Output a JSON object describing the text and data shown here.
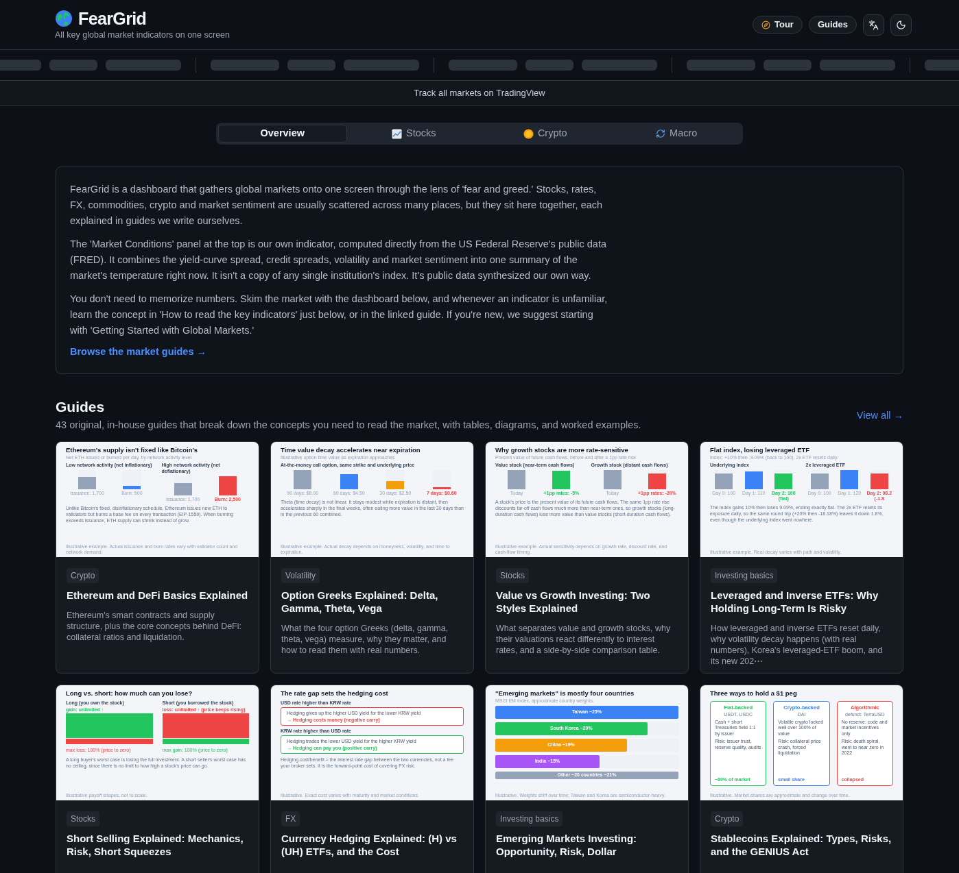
{
  "header": {
    "brand": "FearGrid",
    "tagline": "All key global market indicators on one screen",
    "buttons": [
      {
        "kind": "tour",
        "label": "Tour"
      },
      {
        "kind": "plain",
        "label": "Guides"
      },
      {
        "kind": "translate"
      },
      {
        "kind": "theme"
      }
    ]
  },
  "tradingview_link": "Track all markets on TradingView",
  "tabs": [
    {
      "label": "Overview",
      "selected": true
    },
    {
      "label": "Stocks",
      "selected": false
    },
    {
      "label": "Crypto",
      "selected": false
    },
    {
      "label": "Macro",
      "selected": false
    }
  ],
  "intro": {
    "paragraphs": [
      "FearGrid is a dashboard that gathers global markets onto one screen through the lens of 'fear and greed.' Stocks, rates, FX, commodities, crypto and market sentiment are usually scattered across many places, but they sit here together, each explained in guides we write ourselves.",
      "The 'Market Conditions' panel at the top is our own indicator, computed directly from the US Federal Reserve's public data (FRED). It combines the yield-curve spread, credit spreads, volatility and market sentiment into one summary of the market's temperature right now. It isn't a copy of any single institution's index. It's public data synthesized our own way.",
      "You don't need to memorize numbers. Skim the market with the dashboard below, and whenever an indicator is unfamiliar, learn the concept in 'How to read the key indicators' just below, or in the linked guide. If you're new, we suggest starting with 'Getting Started with Global Markets.'"
    ],
    "link": "Browse the market guides →"
  },
  "guides": {
    "title": "Guides",
    "subtitle": "43 original, in-house guides that break down the concepts you need to read the market, with tables, diagrams, and worked examples.",
    "view_all": "View all →",
    "cards": [
      {
        "category": "Crypto",
        "title": "Ethereum and DeFi Basics Explained",
        "description": "Ethereum's smart contracts and supply structure, plus the core concepts behind DeFi: collateral ratios and liquidation.",
        "thumb": {
          "kind": "bars",
          "title": "Ethereum's supply isn't fixed like Bitcoin's",
          "subtitle": "Net ETH issued or burned per day, by network activity level",
          "groups": [
            {
              "heading": "Low network activity (net inflationary)",
              "bars": [
                {
                  "label": "Issuance: 1,700",
                  "level": 0.65,
                  "color": "#94a3b8",
                  "highlight": false
                },
                {
                  "label": "Burn: 500",
                  "level": 0.18,
                  "color": "#3b82f6",
                  "highlight": false
                }
              ]
            },
            {
              "heading": "High network activity (net deflationary)",
              "bars": [
                {
                  "label": "Issuance: 1,700",
                  "level": 0.65,
                  "color": "#94a3b8",
                  "highlight": false
                },
                {
                  "label": "Burn: 2,500",
                  "level": 1,
                  "color": "#ef4444",
                  "highlight": true
                }
              ]
            }
          ],
          "body": "Unlike Bitcoin's fixed, disinflationary schedule, Ethereum issues new ETH to validators but burns a base fee on every transaction (EIP-1559). When burning exceeds issuance, ETH supply can shrink instead of grow.",
          "footnote": "Illustrative example. Actual issuance and burn rates vary with validator count and network demand."
        }
      },
      {
        "category": "Volatility",
        "title": "Option Greeks Explained: Delta, Gamma, Theta, Vega",
        "description": "What the four option Greeks (delta, gamma, theta, vega) measure, why they matter, and how to read them with real numbers.",
        "thumb": {
          "kind": "bars",
          "title": "Time value decay accelerates near expiration",
          "subtitle": "Illustrative option time value as expiration approaches",
          "groups": [
            {
              "heading": "At-the-money call option, same strike and underlying price",
              "bars": [
                {
                  "label": "90 days: $6.00",
                  "level": 1,
                  "color": "#94a3b8",
                  "highlight": false
                },
                {
                  "label": "60 days: $4.50",
                  "level": 0.76,
                  "color": "#3b82f6",
                  "highlight": false
                },
                {
                  "label": "30 days: $2.50",
                  "level": 0.42,
                  "color": "#f59e0b",
                  "highlight": false
                },
                {
                  "label": "7 days: $0.60",
                  "level": 0.1,
                  "color": "#ef4444",
                  "highlight": true
                }
              ]
            }
          ],
          "body": "Theta (time decay) is not linear. It stays modest while expiration is distant, then accelerates sharply in the final weeks, often eating more value in the last 30 days than in the previous 60 combined.",
          "footnote": "Illustrative example. Actual decay depends on moneyness, volatility, and time to expiration."
        }
      },
      {
        "category": "Stocks",
        "title": "Value vs Growth Investing: Two Styles Explained",
        "description": "What separates value and growth stocks, why their valuations react differently to interest rates, and a side-by-side comparison table.",
        "thumb": {
          "kind": "bars",
          "title": "Why growth stocks are more rate-sensitive",
          "subtitle": "Present value of future cash flows, before and after a 1pp rate rise",
          "groups": [
            {
              "heading": "Value stock (near-term cash flows)",
              "bars": [
                {
                  "label": "Today",
                  "level": 1,
                  "color": "#94a3b8",
                  "highlight": false
                },
                {
                  "label": "+1pp rates: -5%",
                  "level": 0.94,
                  "color": "#22c55e",
                  "highlight": true
                }
              ]
            },
            {
              "heading": "Growth stock (distant cash flows)",
              "bars": [
                {
                  "label": "Today",
                  "level": 1,
                  "color": "#94a3b8",
                  "highlight": false
                },
                {
                  "label": "+1pp rates: -20%",
                  "level": 0.8,
                  "color": "#ef4444",
                  "highlight": true
                }
              ]
            }
          ],
          "body": "A stock's price is the present value of its future cash flows. The same 1pp rate rise discounts far-off cash flows much more than near-term ones, so growth stocks (long-duration cash flows) lose more value than value stocks (short-duration cash flows).",
          "footnote": "Illustrative example. Actual sensitivity depends on growth rate, discount rate, and cash-flow timing."
        }
      },
      {
        "category": "Investing basics",
        "title": "Leveraged and Inverse ETFs: Why Holding Long-Term Is Risky",
        "description": "How leveraged and inverse ETFs reset daily, why volatility decay happens (with real numbers), Korea's leveraged-ETF boom, and its new 202⋯",
        "thumb": {
          "kind": "bars",
          "title": "Flat index, losing leveraged ETF",
          "subtitle": "Index: +10% then -9.09% (back to 100). 2x ETF resets daily.",
          "groups": [
            {
              "heading": "Underlying index",
              "bars": [
                {
                  "label": "Day 0: 100",
                  "level": 0.83,
                  "color": "#94a3b8",
                  "highlight": false
                },
                {
                  "label": "Day 1: 110",
                  "level": 0.92,
                  "color": "#3b82f6",
                  "highlight": false
                },
                {
                  "label": "Day 2: 100 (flat)",
                  "level": 0.83,
                  "color": "#22c55e",
                  "highlight": true
                }
              ]
            },
            {
              "heading": "2x leveraged ETF",
              "bars": [
                {
                  "label": "Day 0: 100",
                  "level": 0.83,
                  "color": "#94a3b8",
                  "highlight": false
                },
                {
                  "label": "Day 1: 120",
                  "level": 1,
                  "color": "#3b82f6",
                  "highlight": false
                },
                {
                  "label": "Day 2: 98.2 (-1.8",
                  "level": 0.82,
                  "color": "#ef4444",
                  "highlight": true
                }
              ]
            }
          ],
          "body": "The index gains 10% then loses 9.09%, ending exactly flat. The 2x ETF resets its exposure daily, so the same round trip (+20% then -18.18%) leaves it down 1.8%, even though the underlying index went nowhere.",
          "footnote": "Illustrative example. Real decay varies with path and volatility."
        }
      },
      {
        "category": "Stocks",
        "title": "Short Selling Explained: Mechanics, Risk, Short Squeezes",
        "thumb": {
          "kind": "payoff",
          "title": "Long vs. short: how much can you lose?",
          "columns": [
            {
              "heading": "Long (you own the stock)",
              "top": {
                "note": "gain: unlimited ↑",
                "color": "#22c55e"
              },
              "bottom": {
                "note": "max loss: 100% (price to zero)",
                "color": "#ef4444"
              }
            },
            {
              "heading": "Short (you borrowed the stock)",
              "top": {
                "note": "loss: unlimited ↑ (price keeps rising)",
                "color": "#ef4444"
              },
              "bottom": {
                "note": "max gain: 100% (price to zero)",
                "color": "#22c55e"
              }
            }
          ],
          "body": "A long buyer's worst case is losing the full investment. A short seller's worst case has no ceiling, since there is no limit to how high a stock's price can go.",
          "footnote": "Illustrative payoff shapes, not to scale."
        }
      },
      {
        "category": "FX",
        "title": "Currency Hedging Explained: (H) vs (UH) ETFs, and the Cost",
        "thumb": {
          "kind": "boxes",
          "title": "The rate gap sets the hedging cost",
          "sections": [
            {
              "heading": "USD rate higher than KRW rate",
              "text": "Hedging gives up the higher USD yield for the lower KRW yield",
              "result": "→ Hedging costs money (negative carry)",
              "color": "#ef4444"
            },
            {
              "heading": "KRW rate higher than USD rate",
              "text": "Hedging trades the lower USD yield for the higher KRW yield",
              "result": "→ Hedging can pay you (positive carry)",
              "color": "#22c55e"
            }
          ],
          "body": "Hedging cost/benefit ≈ the interest rate gap between the two currencies, not a fee your broker sets. It is the forward-point cost of covering FX risk.",
          "footnote": "Illustrative. Exact cost varies with maturity and market conditions."
        }
      },
      {
        "category": "Investing basics",
        "title": "Emerging Markets Investing: Opportunity, Risk, Dollar",
        "thumb": {
          "kind": "hbars",
          "title": "\"Emerging markets\" is mostly four countries",
          "subtitle": "MSCI EM Index, approximate country weights.",
          "bars": [
            {
              "label": "Taiwan ~25%",
              "level": 1,
              "color": "#3b82f6"
            },
            {
              "label": "South Korea ~20%",
              "level": 0.83,
              "color": "#22c55e"
            },
            {
              "label": "China ~19%",
              "level": 0.72,
              "color": "#f59e0b"
            },
            {
              "label": "India ~15%",
              "level": 0.57,
              "color": "#a855f7"
            },
            {
              "label": "Other ~20 countries ~21%",
              "level": 1,
              "color": "#94a3b8"
            }
          ],
          "footnote": "Illustrative. Weights shift over time; Taiwan and Korea are semiconductor-heavy."
        }
      },
      {
        "category": "Crypto",
        "title": "Stablecoins Explained: Types, Risks, and the GENIUS Act",
        "thumb": {
          "kind": "columns",
          "title": "Three ways to hold a $1 peg",
          "cards": [
            {
              "title": "Fiat-backed",
              "subtitle": "USDT, USDC",
              "text": "Cash + short Treasuries held 1:1 by issuer",
              "risk": "Risk: issuer trust, reserve quality, audits",
              "share": "~80% of market",
              "color": "#22c55e"
            },
            {
              "title": "Crypto-backed",
              "subtitle": "DAI",
              "text": "Volatile crypto locked well over 100% of value",
              "risk": "Risk: collateral price crash, forced liquidation",
              "share": "small share",
              "color": "#3b82f6"
            },
            {
              "title": "Algorithmic",
              "subtitle": "defunct: TerraUSD",
              "text": "No reserve: code and market incentives only",
              "risk": "Risk: death spiral, went to near zero in 2022",
              "share": "collapsed",
              "color": "#ef4444"
            }
          ],
          "footnote": "Illustrative. Market shares are approximate and change over time."
        }
      }
    ]
  }
}
